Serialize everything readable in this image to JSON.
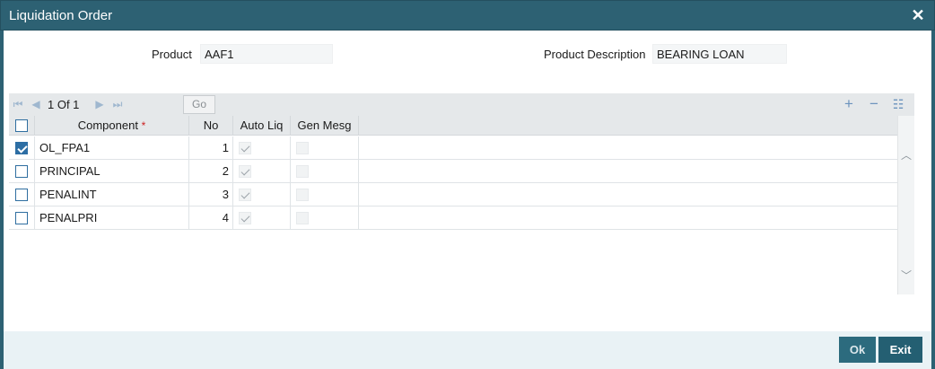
{
  "window": {
    "title": "Liquidation Order",
    "close_icon": "close-icon"
  },
  "form": {
    "product_label": "Product",
    "product_value": "AAF1",
    "product_desc_label": "Product Description",
    "product_desc_value": "BEARING LOAN"
  },
  "toolbar": {
    "pager": "1 Of 1",
    "go_label": "Go",
    "icons": [
      "first-page-icon",
      "prev-page-icon",
      "next-page-icon",
      "last-page-icon",
      "add-row-icon",
      "delete-row-icon",
      "view-options-icon"
    ]
  },
  "table": {
    "columns": [
      "Component",
      "No",
      "Auto Liq",
      "Gen Mesg"
    ],
    "required_mark": "*",
    "rows": [
      {
        "component": "OL_FPA1",
        "no": "1",
        "selected": true,
        "auto_liq": true,
        "gen_mesg": false
      },
      {
        "component": "PRINCIPAL",
        "no": "2",
        "selected": false,
        "auto_liq": true,
        "gen_mesg": false
      },
      {
        "component": "PENALINT",
        "no": "3",
        "selected": false,
        "auto_liq": true,
        "gen_mesg": false
      },
      {
        "component": "PENALPRI",
        "no": "4",
        "selected": false,
        "auto_liq": true,
        "gen_mesg": false
      }
    ]
  },
  "footer": {
    "ok_label": "Ok",
    "exit_label": "Exit"
  },
  "colors": {
    "header": "#2d6173",
    "accent": "#2d6ea4",
    "footer": "#e9f2f5"
  }
}
